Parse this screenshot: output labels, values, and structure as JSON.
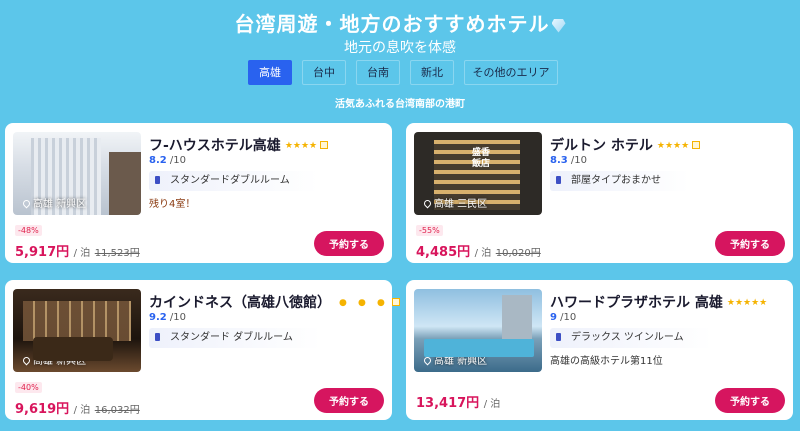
{
  "header": {
    "title": "台湾周遊・地方のおすすめホテル",
    "subtitle": "地元の息吹を体感",
    "region_desc": "活気あふれる台湾南部の港町"
  },
  "tabs": [
    {
      "label": "高雄",
      "active": true
    },
    {
      "label": "台中",
      "active": false
    },
    {
      "label": "台南",
      "active": false
    },
    {
      "label": "新北",
      "active": false
    },
    {
      "label": "その他のエリア",
      "active": false
    }
  ],
  "hotels": [
    {
      "name": "フ-ハウスホテル高雄",
      "stars": "★★★★",
      "score": "8.2",
      "score_suffix": "/10",
      "room": "スタンダードダブルルーム",
      "note": "残り4室！",
      "location": "高雄 新興区",
      "discount": "-48%",
      "price": "5,917円",
      "per_night": "/ 泊",
      "original_price": "11,523円",
      "button": "予約する"
    },
    {
      "name": "デルトン ホテル",
      "stars": "★★★★",
      "score": "8.3",
      "score_suffix": "/10",
      "room": "部屋タイプおまかせ",
      "note": "",
      "location": "高雄 三民区",
      "discount": "-55%",
      "price": "4,485円",
      "per_night": "/ 泊",
      "original_price": "10,020円",
      "button": "予約する"
    },
    {
      "name": "カインドネス（高雄八徳館）",
      "stars": "● ● ●",
      "score": "9.2",
      "score_suffix": "/10",
      "room": "スタンダード ダブルルーム",
      "note": "",
      "location": "高雄 新興区",
      "discount": "-40%",
      "price": "9,619円",
      "per_night": "/ 泊",
      "original_price": "16,032円",
      "button": "予約する"
    },
    {
      "name": "ハワードプラザホテル 高雄",
      "stars": "★★★★★",
      "score": "9",
      "score_suffix": "/10",
      "room": "デラックス ツインルーム",
      "note": "高雄の高級ホテル第11位",
      "location": "高雄 新興区",
      "discount": "",
      "price": "13,417円",
      "per_night": "/ 泊",
      "original_price": "",
      "button": "予約する"
    }
  ],
  "colors": {
    "background": "#5cc6ea",
    "active_tab": "#2962ef",
    "price": "#d8155c",
    "button": "#d6155f",
    "star": "#f5b301"
  }
}
